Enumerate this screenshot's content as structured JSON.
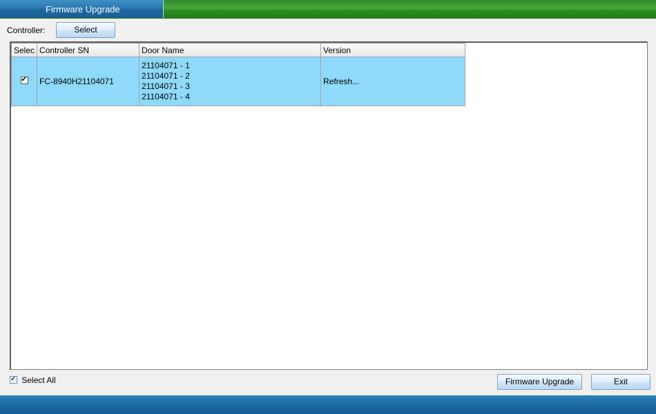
{
  "window": {
    "title": "Firmware Upgrade"
  },
  "controller": {
    "label": "Controller:",
    "select_button": "Select"
  },
  "table": {
    "columns": [
      "Selec",
      "Controller SN",
      "Door Name",
      "Version"
    ],
    "rows": [
      {
        "selected": true,
        "sn": "FC-8940H21104071",
        "doors": [
          "21104071 - 1",
          "21104071 - 2",
          "21104071 - 3",
          "21104071 - 4"
        ],
        "version": "Refresh..."
      }
    ]
  },
  "select_all": {
    "label": "Select All",
    "checked": true
  },
  "buttons": {
    "upgrade": "Firmware Upgrade",
    "exit": "Exit"
  },
  "colors": {
    "row_selected": "#8fd9fb",
    "title_blue": "#2a78b0",
    "title_green": "#3f9d33"
  }
}
